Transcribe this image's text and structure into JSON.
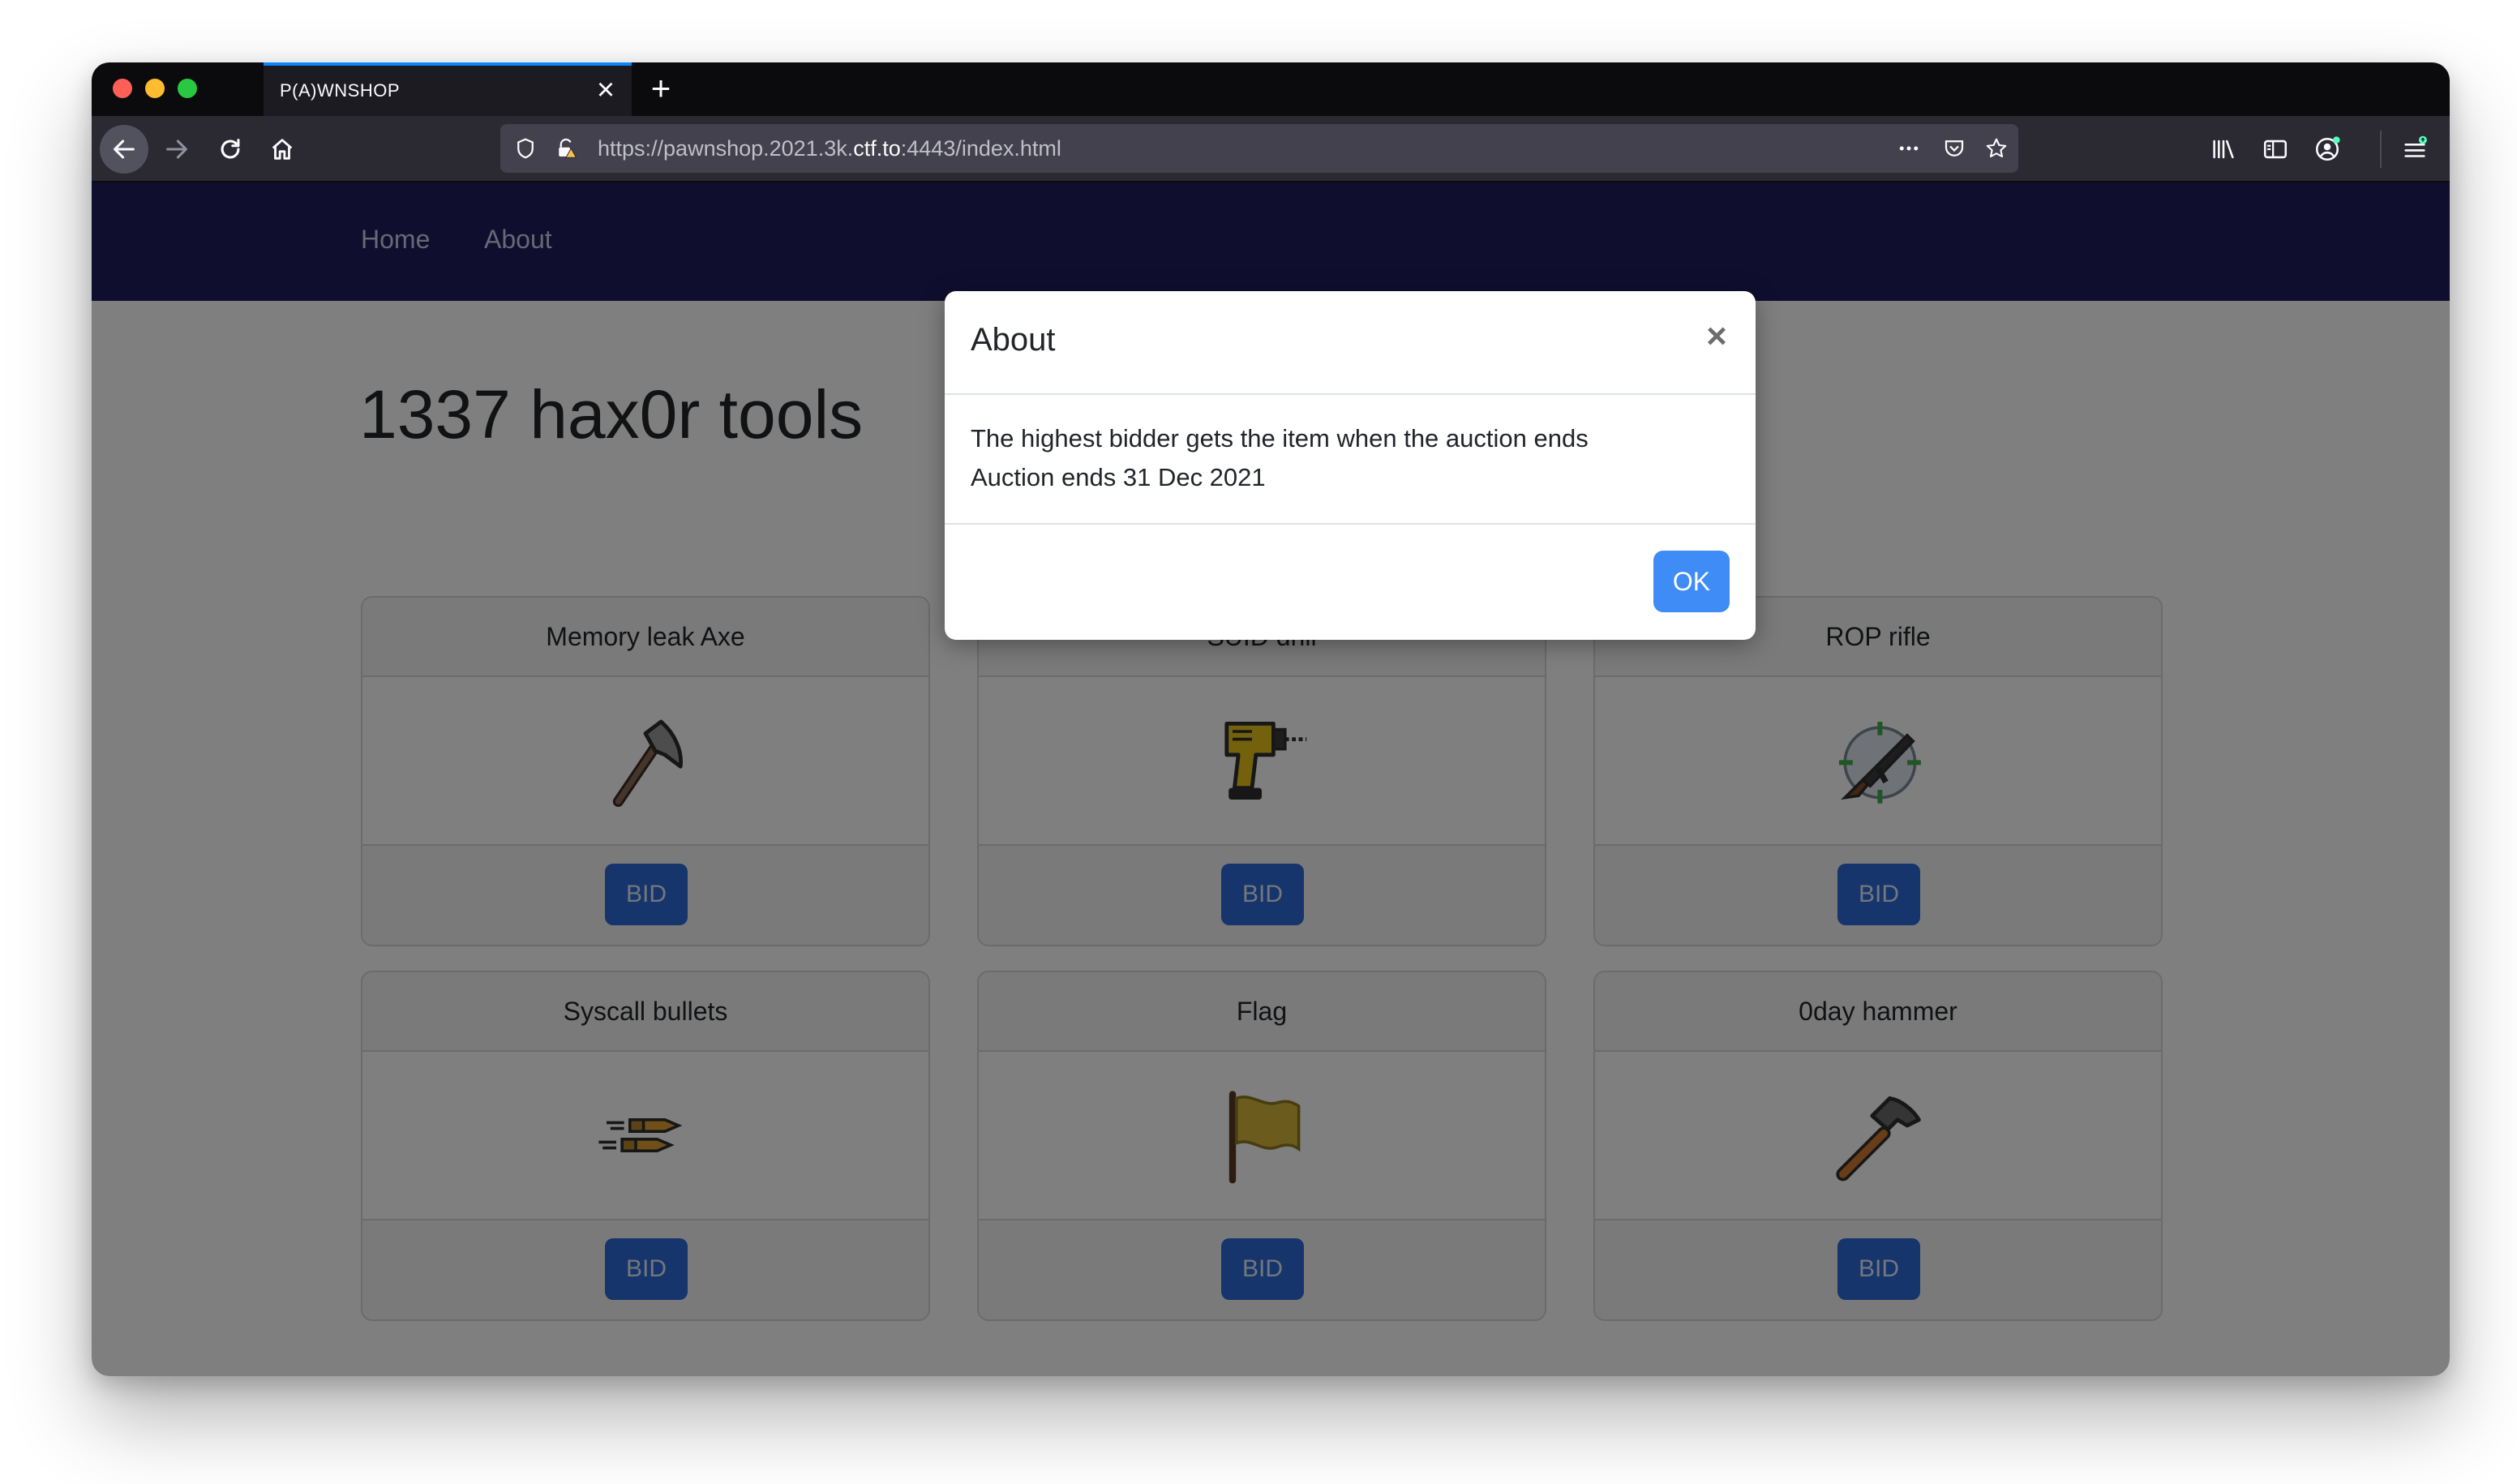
{
  "browser": {
    "tab_title": "P(A)WNSHOP",
    "tab_close": "×",
    "new_tab": "+",
    "url_prefix": "https://pawnshop.2021.3k.",
    "url_host": "ctf.to",
    "url_suffix": ":4443/index.html"
  },
  "nav": {
    "home": "Home",
    "about": "About"
  },
  "page": {
    "heading": "1337 hax0r tools"
  },
  "items": [
    {
      "name": "Memory leak Axe",
      "icon": "axe-icon",
      "bid": "BID"
    },
    {
      "name": "SUID drill",
      "icon": "drill-icon",
      "bid": "BID"
    },
    {
      "name": "ROP rifle",
      "icon": "rifle-icon",
      "bid": "BID"
    },
    {
      "name": "Syscall bullets",
      "icon": "bullets-icon",
      "bid": "BID"
    },
    {
      "name": "Flag",
      "icon": "flag-icon",
      "bid": "BID"
    },
    {
      "name": "0day hammer",
      "icon": "hammer-icon",
      "bid": "BID"
    }
  ],
  "modal": {
    "title": "About",
    "close": "×",
    "line1": "The highest bidder gets the item when the auction ends",
    "line2": "Auction ends 31 Dec 2021",
    "ok": "OK"
  }
}
